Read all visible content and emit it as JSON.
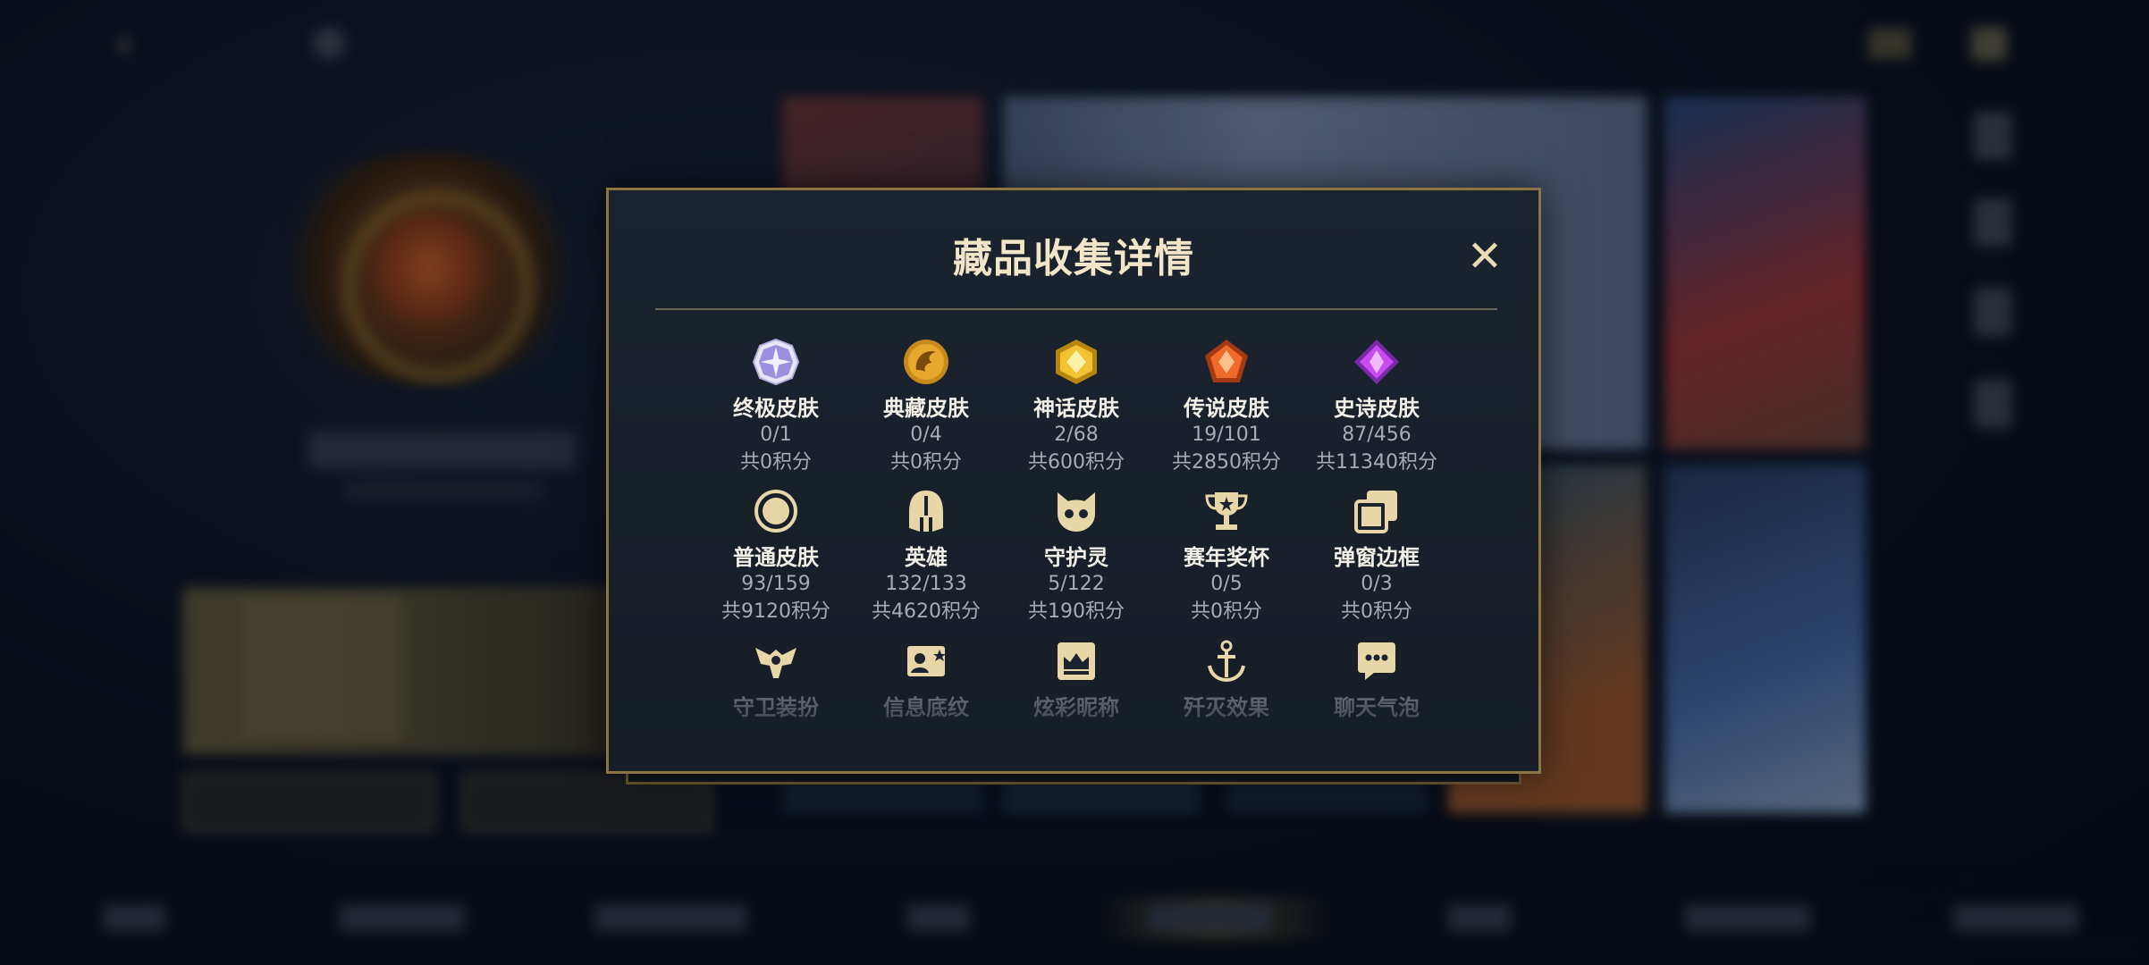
{
  "modal": {
    "title": "藏品收集详情",
    "close_label": "✕",
    "items": [
      {
        "name": "终极皮肤",
        "count": "0/1",
        "points": "共0积分",
        "icon": "ultimate-skin-icon"
      },
      {
        "name": "典藏皮肤",
        "count": "0/4",
        "points": "共0积分",
        "icon": "collection-skin-icon"
      },
      {
        "name": "神话皮肤",
        "count": "2/68",
        "points": "共600积分",
        "icon": "myth-skin-icon"
      },
      {
        "name": "传说皮肤",
        "count": "19/101",
        "points": "共2850积分",
        "icon": "legend-skin-icon"
      },
      {
        "name": "史诗皮肤",
        "count": "87/456",
        "points": "共11340积分",
        "icon": "epic-skin-icon"
      },
      {
        "name": "普通皮肤",
        "count": "93/159",
        "points": "共9120积分",
        "icon": "normal-skin-icon"
      },
      {
        "name": "英雄",
        "count": "132/133",
        "points": "共4620积分",
        "icon": "hero-helmet-icon"
      },
      {
        "name": "守护灵",
        "count": "5/122",
        "points": "共190积分",
        "icon": "guardian-spirit-icon"
      },
      {
        "name": "赛年奖杯",
        "count": "0/5",
        "points": "共0积分",
        "icon": "trophy-icon"
      },
      {
        "name": "弹窗边框",
        "count": "0/3",
        "points": "共0积分",
        "icon": "popup-frame-icon"
      },
      {
        "name": "守卫装扮",
        "icon": "guard-outfit-icon"
      },
      {
        "name": "信息底纹",
        "icon": "info-background-icon"
      },
      {
        "name": "炫彩昵称",
        "icon": "colorful-nickname-icon"
      },
      {
        "name": "歼灭效果",
        "icon": "elimination-effect-icon"
      },
      {
        "name": "聊天气泡",
        "icon": "chat-bubble-icon"
      }
    ]
  },
  "colors": {
    "modal_border": "#8b7545",
    "title": "#f1e6c8",
    "label": "#f2efe6",
    "secondary": "#a7abb3",
    "gold_icon": "#e6d6a8"
  }
}
